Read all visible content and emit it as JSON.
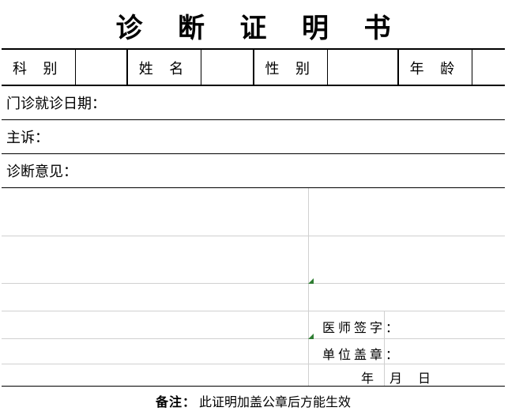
{
  "title": "诊 断 证 明 书",
  "header": {
    "dept_label": "科 别",
    "dept_value": "",
    "name_label": "姓 名",
    "name_value": "",
    "sex_label": "性 别",
    "sex_value": "",
    "age_label": "年 龄",
    "age_value": ""
  },
  "sections": {
    "visit_date_label": "门诊就诊日期：",
    "visit_date_value": "",
    "complaint_label": "主诉：",
    "complaint_value": "",
    "diagnosis_label": "诊断意见：",
    "diagnosis_value": ""
  },
  "signature": {
    "doctor_label": "医 师 签 字 ：",
    "doctor_value": "",
    "seal_label": "单 位 盖 章 ：",
    "seal_value": "",
    "date": {
      "year": "年",
      "month": "月",
      "day": "日"
    }
  },
  "footnote": {
    "label": "备注：",
    "text": "此证明加盖公章后方能生效"
  }
}
